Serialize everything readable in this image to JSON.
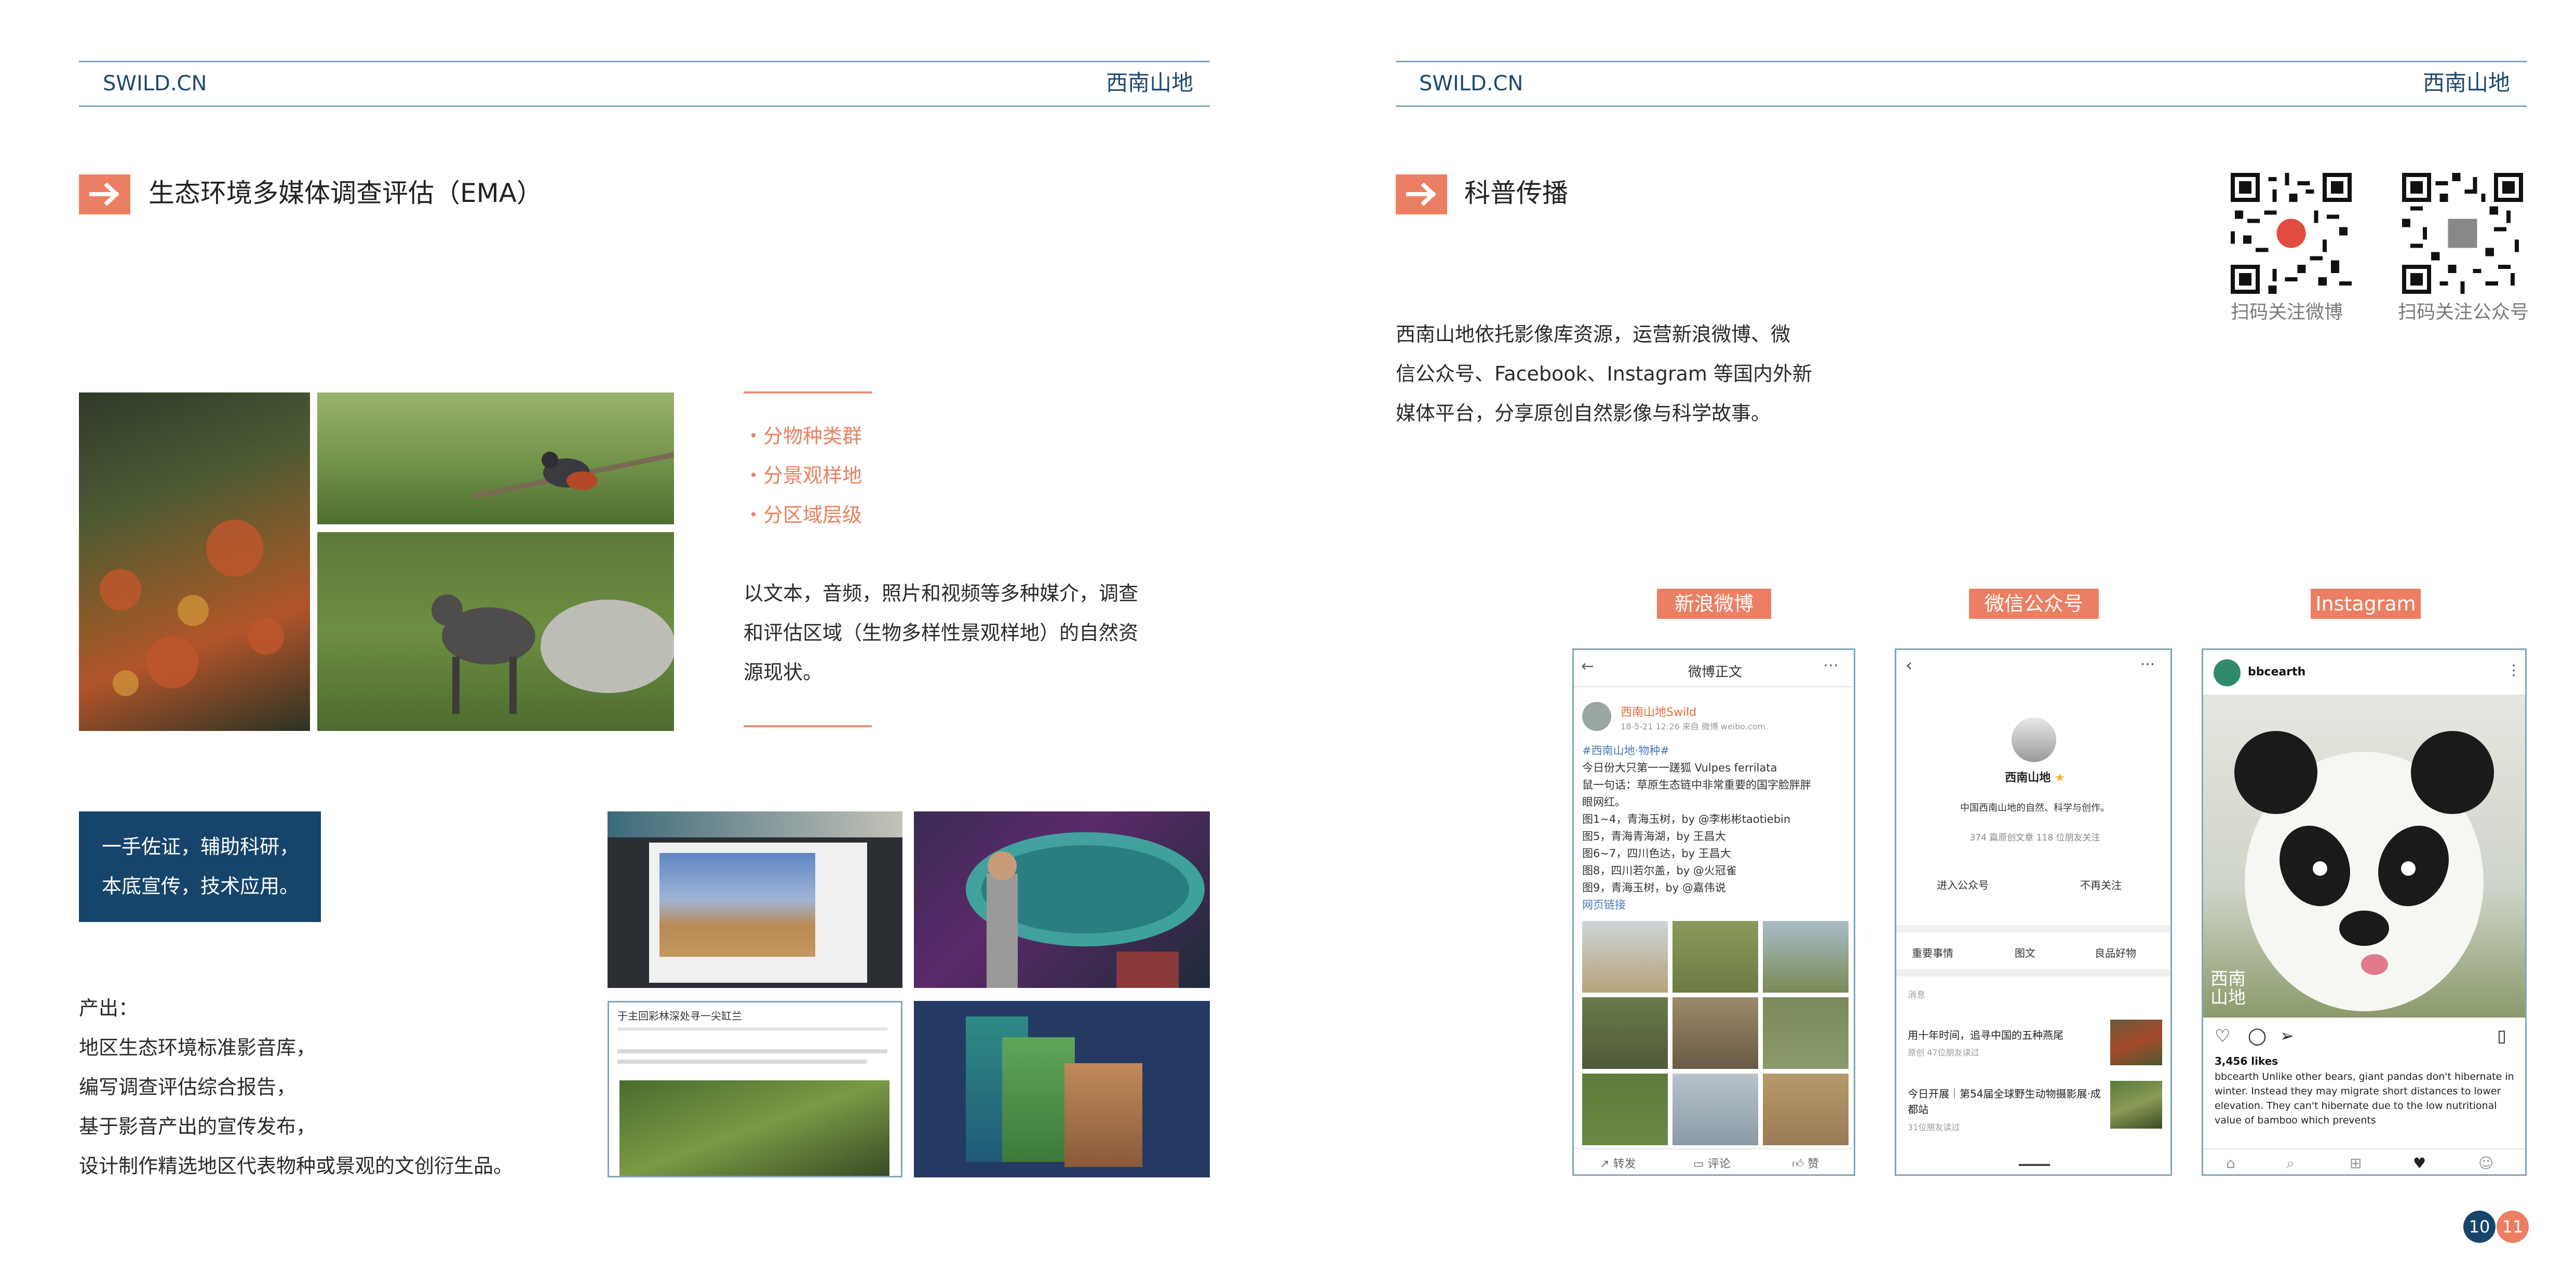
{
  "left_page": {
    "site": "SWILD.CN",
    "brand": "西南山地",
    "section_title": "生态环境多媒体调查评估（EMA）",
    "bullets": [
      "・分物种类群",
      "・分景观样地",
      "・分区域层级"
    ],
    "description": [
      "以文本，音频，照片和视频等多种媒介，调查",
      "和评估区域（生物多样性景观样地）的自然资",
      "源现状。"
    ],
    "highlight_box": [
      "一手佐证，辅助科研，",
      "本底宣传，技术应用。"
    ],
    "output_title": "产出：",
    "outputs": [
      "地区生态环境标准影音库，",
      "编写调查评估综合报告，",
      "基于影音产出的宣传发布，",
      "设计制作精选地区代表物种或景观的文创衍生品。"
    ],
    "article_title": "于主回彩林深处寻一尖缸兰",
    "page_number": "10"
  },
  "right_page": {
    "site": "SWILD.CN",
    "brand": "西南山地",
    "section_title": "科普传播",
    "description": [
      "西南山地依托影像库资源，运营新浪微博、微",
      "信公众号、Facebook、Instagram 等国内外新",
      "媒体平台，分享原创自然影像与科学故事。"
    ],
    "qr_captions": [
      "扫码关注微博",
      "扫码关注公众号"
    ],
    "tags": [
      "新浪微博",
      "微信公众号",
      "Instagram"
    ],
    "weibo": {
      "header": "微博正文",
      "account": "西南山地Swild",
      "meta": "18-5-21 12:26  来自 微博 weibo.com",
      "lines": [
        "#西南山地·物种#",
        "今日份大只第一一蹉狐 Vulpes ferrilata",
        "鼠一句话：草原生态链中非常重要的国字脸胖胖",
        "眼网红。",
        "图1~4，青海玉树，by @李彬彬taotiebin",
        "图5，青海青海湖，by 王昌大",
        "图6~7，四川色达，by 王昌大",
        "图8，四川若尔盖，by @火冠雀",
        "图9，青海玉树，by @嘉伟说",
        "网页链接"
      ],
      "actions": [
        "转发",
        "评论",
        "赞"
      ]
    },
    "wechat": {
      "name": "西南山地",
      "slogan": "中国西南山地的自然、科学与创作。",
      "stats": "374 篇原创文章  118 位朋友关注",
      "enter": "进入公众号",
      "unfollow": "不再关注",
      "menu": [
        "重要事情",
        "图文",
        "良品好物"
      ],
      "msg_label": "消息",
      "articles": [
        {
          "title": "用十年时间，追寻中国的五种燕尾",
          "meta": "原创 47位朋友读过"
        },
        {
          "title": "今日开展｜第54届全球野生动物摄影展·成都站",
          "meta": "31位朋友读过"
        }
      ]
    },
    "instagram": {
      "account": "bbcearth",
      "watermark": "西南山地",
      "likes": "3,456 likes",
      "caption": "bbcearth Unlike other bears, giant pandas don't hibernate in winter. Instead they may migrate short distances to lower elevation. They can't hibernate due to the low nutritional value of bamboo which prevents"
    },
    "page_number": "11"
  },
  "colors": {
    "accent": "#ec7f63",
    "navy": "#1d4a6e",
    "rule": "#7fa6bd"
  }
}
